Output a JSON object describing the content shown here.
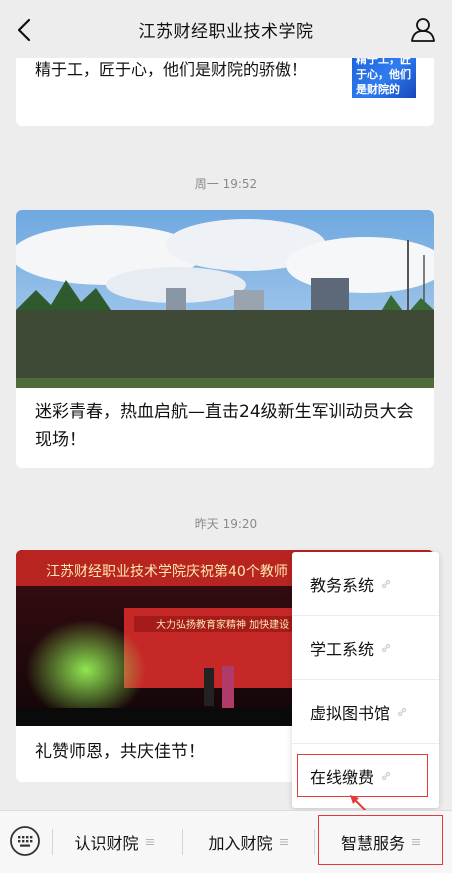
{
  "header": {
    "title": "江苏财经职业技术学院",
    "back_icon": "chevron-left-icon",
    "profile_icon": "person-icon"
  },
  "feed": {
    "card1": {
      "text": "精于工，匠于心，他们是财院的骄傲！",
      "thumb_text": "精于工，匠于心，他们是财院的"
    },
    "time1": "周一 19:52",
    "card2": {
      "text": "迷彩青春，热血启航—直击24级新生军训动员大会现场！"
    },
    "time2": "昨天 19:20",
    "card3": {
      "banner_text": "江苏财经职业技术学院庆祝第40个教师",
      "stage_text": "大力弘扬教育家精神  加快建设",
      "text": "礼赞师恩，共庆佳节！"
    }
  },
  "menu": {
    "items": [
      {
        "label": "教务系统",
        "icon": "link-icon"
      },
      {
        "label": "学工系统",
        "icon": "link-icon"
      },
      {
        "label": "虚拟图书馆",
        "icon": "link-icon"
      },
      {
        "label": "在线缴费",
        "icon": "link-icon"
      }
    ]
  },
  "bottom": {
    "keyboard_icon": "keyboard-icon",
    "tabs": [
      {
        "label": "认识财院"
      },
      {
        "label": "加入财院"
      },
      {
        "label": "智慧服务"
      }
    ]
  },
  "colors": {
    "background": "#ededed",
    "annotation": "#e23b3b",
    "card": "#ffffff",
    "timestamp": "#8a8a8a"
  }
}
